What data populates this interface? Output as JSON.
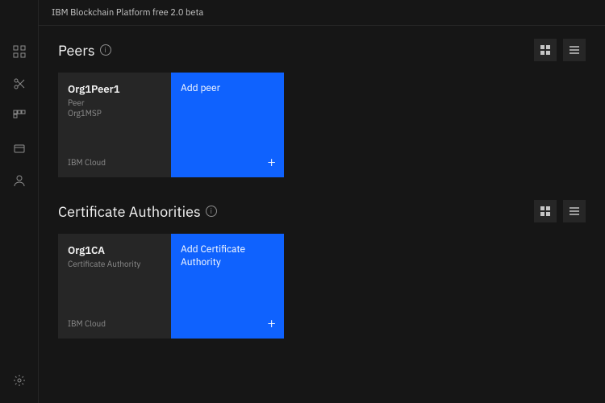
{
  "topbar": {
    "title": "IBM Blockchain Platform free 2.0 beta"
  },
  "sidebar": {
    "items": [
      {
        "name": "nodes",
        "icon": "grid"
      },
      {
        "name": "channels",
        "icon": "cut"
      },
      {
        "name": "smart-contracts",
        "icon": "apps"
      },
      {
        "name": "wallet",
        "icon": "wallet"
      },
      {
        "name": "users",
        "icon": "user"
      },
      {
        "name": "settings",
        "icon": "gear"
      }
    ]
  },
  "sections": {
    "peers": {
      "title": "Peers",
      "card": {
        "title": "Org1Peer1",
        "type": "Peer",
        "msp": "Org1MSP",
        "location": "IBM Cloud"
      },
      "add_label": "Add peer"
    },
    "cas": {
      "title": "Certificate Authorities",
      "card": {
        "title": "Org1CA",
        "type": "Certificate Authority",
        "location": "IBM Cloud"
      },
      "add_label": "Add Certificate Authority"
    }
  }
}
